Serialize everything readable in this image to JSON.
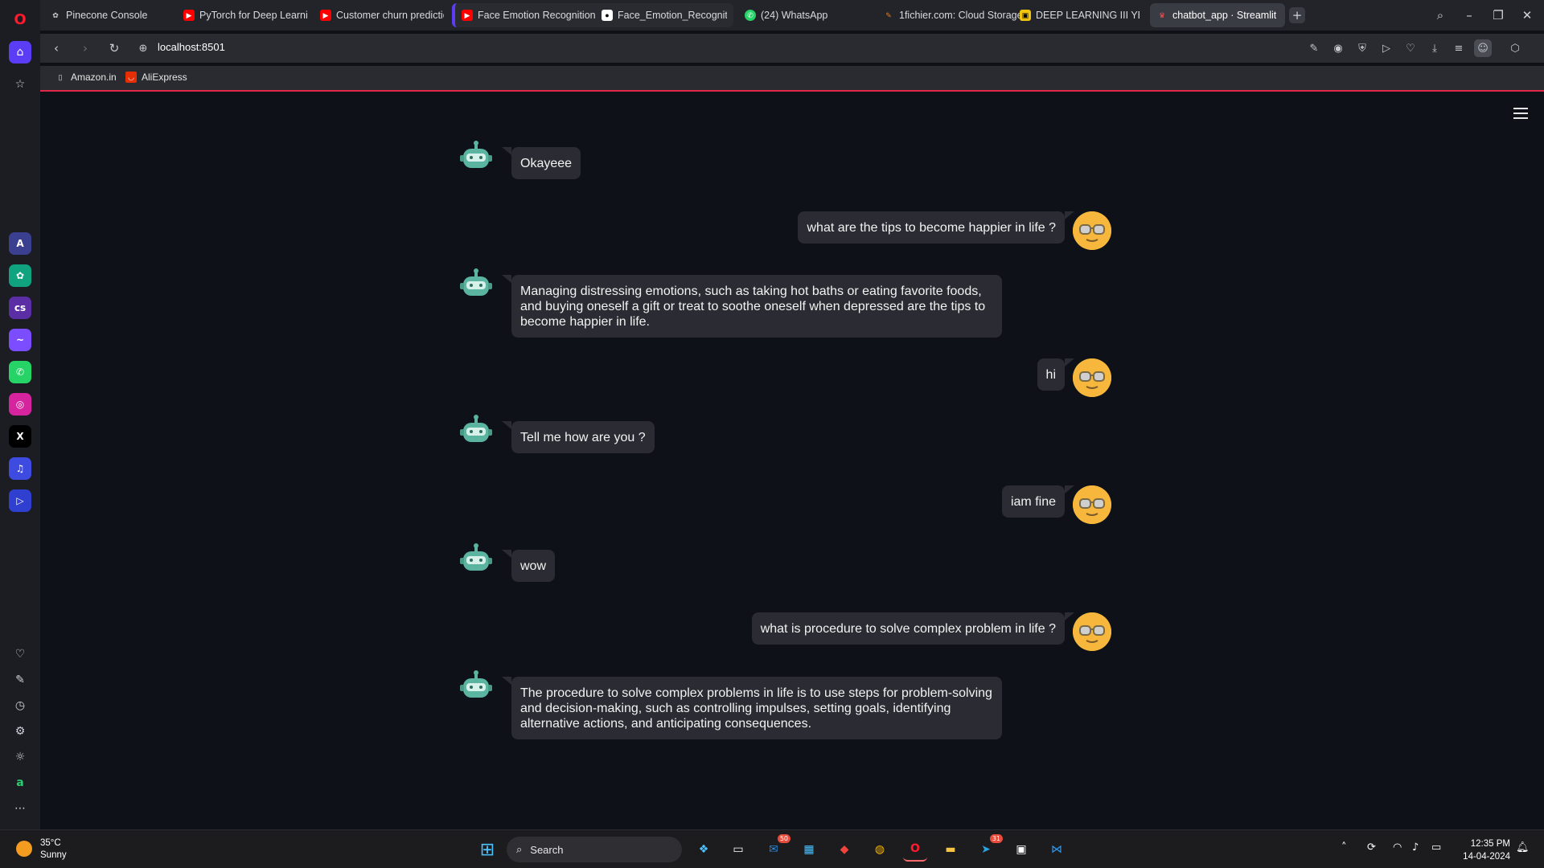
{
  "tabs": [
    {
      "title": "Pinecone Console",
      "icon": "pinecone-icon",
      "color": "#3a3c44"
    },
    {
      "title": "PyTorch for Deep Learning",
      "icon": "youtube-icon",
      "color": "#ff0000"
    },
    {
      "title": "Customer churn prediction",
      "icon": "youtube-icon",
      "color": "#ff0000"
    },
    {
      "title": "Face Emotion Recognition",
      "icon": "youtube-icon",
      "color": "#ff0000"
    },
    {
      "title": "Face_Emotion_Recognition",
      "icon": "github-icon",
      "color": "#ffffff"
    },
    {
      "title": "(24) WhatsApp",
      "icon": "whatsapp-icon",
      "color": "#25d366"
    },
    {
      "title": "1fichier.com: Cloud Storage",
      "icon": "1fichier-icon",
      "color": "#e67e22"
    },
    {
      "title": "DEEP LEARNING III YEAR",
      "icon": "image-icon",
      "color": "#f1c40f"
    },
    {
      "title": "chatbot_app · Streamlit",
      "icon": "streamlit-icon",
      "color": "#ff4b4b"
    }
  ],
  "address": {
    "url": "localhost:8501"
  },
  "bookmarks": [
    {
      "label": "Amazon.in",
      "icon": "page-icon"
    },
    {
      "label": "AliExpress",
      "icon": "aliexpress-icon"
    }
  ],
  "chat": [
    {
      "role": "bot",
      "text": "Okayeee"
    },
    {
      "role": "user",
      "text": "what are the tips to become happier in life ?"
    },
    {
      "role": "bot",
      "text": "Managing distressing emotions, such as taking hot baths or eating favorite foods, and buying oneself a gift or treat to soothe oneself when depressed are the tips to become happier in life."
    },
    {
      "role": "user",
      "text": "hi"
    },
    {
      "role": "bot",
      "text": "Tell me how are you ?"
    },
    {
      "role": "user",
      "text": "iam fine"
    },
    {
      "role": "bot",
      "text": "wow"
    },
    {
      "role": "user",
      "text": "what is procedure to solve complex problem in life ?"
    },
    {
      "role": "bot",
      "text": "The procedure to solve complex problems in life is to use steps for problem-solving and decision-making, such as controlling impulses, setting goals, identifying alternative actions, and anticipating consequences."
    }
  ],
  "taskbar": {
    "weather_temp": "35°C",
    "weather_desc": "Sunny",
    "search_label": "Search",
    "mail_badge": "50",
    "telegram_badge": "31",
    "time": "12:35 PM",
    "date": "14-04-2024"
  },
  "colors": {
    "accent": "#e0284a",
    "user_avatar": "#f6b73c",
    "bot_avatar": "#5ab4a0",
    "bubble": "#2b2c33",
    "background": "#0e1117"
  }
}
